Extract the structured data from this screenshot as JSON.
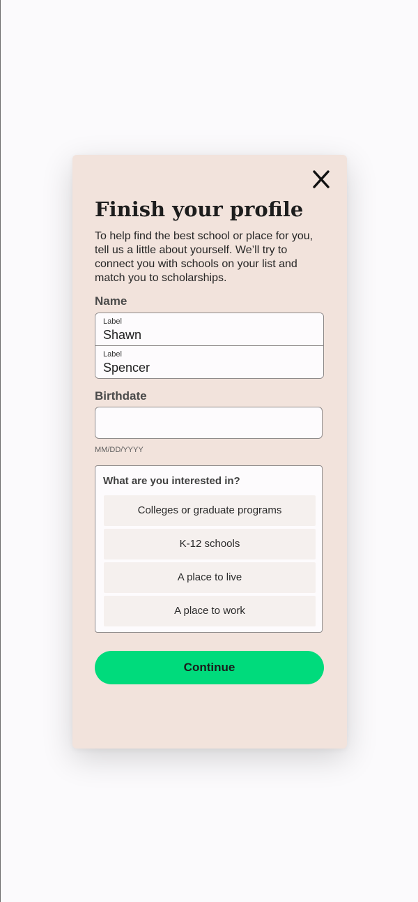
{
  "modal": {
    "close_icon": "close-icon",
    "title": "Finish your profile",
    "intro": "To help find the best school or place for you, tell us a little about yourself. We’ll try to connect you with schools on your list and match you to scholarships."
  },
  "name_section": {
    "label": "Name",
    "first": {
      "field_label": "Label",
      "value": "Shawn"
    },
    "last": {
      "field_label": "Label",
      "value": "Spencer"
    }
  },
  "birthdate_section": {
    "label": "Birthdate",
    "value": "",
    "hint": "MM/DD/YYYY"
  },
  "interests": {
    "title": "What are you interested in?",
    "options": [
      "Colleges or graduate programs",
      "K-12 schools",
      "A place to live",
      "A place to work"
    ]
  },
  "actions": {
    "continue_label": "Continue"
  },
  "colors": {
    "modal_background": "#f2e3dc",
    "page_background": "#fbfafc",
    "continue_button": "#00db7c",
    "field_border": "#8e8a8a"
  }
}
